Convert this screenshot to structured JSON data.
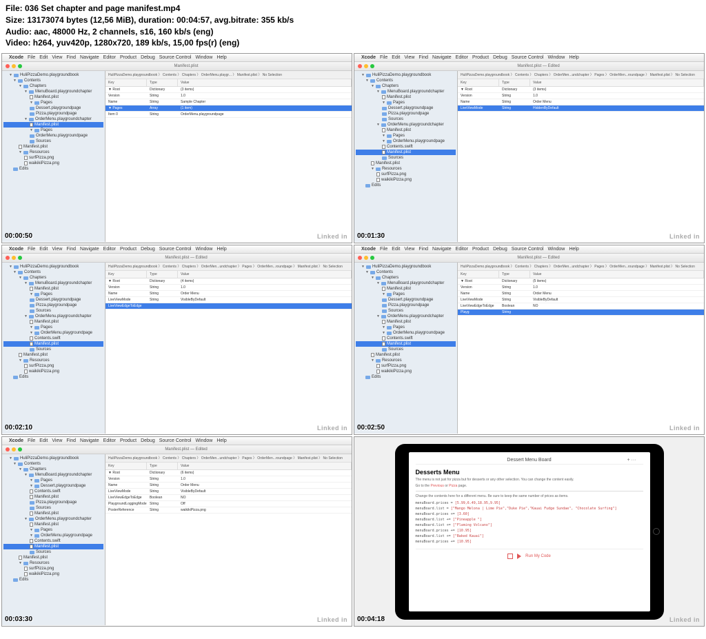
{
  "header": {
    "l1": "File: 036 Set chapter and page manifest.mp4",
    "l2": "Size: 13173074 bytes (12,56 MiB), duration: 00:04:57, avg.bitrate: 355 kb/s",
    "l3": "Audio: aac, 48000 Hz, 2 channels, s16, 160 kb/s (eng)",
    "l4": "Video: h264, yuv420p, 1280x720, 189 kb/s, 15,00 fps(r) (eng)"
  },
  "menu": [
    "Xcode",
    "File",
    "Edit",
    "View",
    "Find",
    "Navigate",
    "Editor",
    "Product",
    "Debug",
    "Source Control",
    "Window",
    "Help"
  ],
  "watermark": "Linked in",
  "plist_cols": {
    "key": "Key",
    "type": "Type",
    "value": "Value"
  },
  "thumbs": [
    {
      "ts": "00:00:50",
      "title": "Manifest.plist",
      "crumb": "HuliPizzaDemo.playgroundbook 〉 Contents 〉 Chapters 〉 OrderMenu.playgr... 〉 Manifest.plist 〉 No Selection",
      "tree": [
        {
          "t": "HuliPizzaDemo.playgroundbook",
          "d": 0,
          "o": 1,
          "f": 1
        },
        {
          "t": "Contents",
          "d": 1,
          "o": 1,
          "f": 1
        },
        {
          "t": "Chapters",
          "d": 2,
          "o": 1,
          "f": 1
        },
        {
          "t": "MenuBoard.playgroundchapter",
          "d": 3,
          "o": 1,
          "f": 1
        },
        {
          "t": "Manifest.plist",
          "d": 4
        },
        {
          "t": "Pages",
          "d": 4,
          "o": 1,
          "f": 1
        },
        {
          "t": "Dessert.playgroundpage",
          "d": 4,
          "f": 1
        },
        {
          "t": "Pizza.playgroundpage",
          "d": 4,
          "f": 1
        },
        {
          "t": "OrderMenu.playgroundchapter",
          "d": 3,
          "o": 1,
          "f": 1
        },
        {
          "t": "Manifest.plist",
          "d": 4,
          "sel": 1
        },
        {
          "t": "Pages",
          "d": 4,
          "o": 1,
          "f": 1
        },
        {
          "t": "OrderMenu.playgroundpage",
          "d": 4,
          "f": 1
        },
        {
          "t": "Sources",
          "d": 4,
          "f": 1
        },
        {
          "t": "Manifest.plist",
          "d": 2
        },
        {
          "t": "Resources",
          "d": 2,
          "o": 1,
          "f": 1
        },
        {
          "t": "surfPizza.png",
          "d": 3
        },
        {
          "t": "waikikiPizza.png",
          "d": 3
        },
        {
          "t": "Edits",
          "d": 1,
          "f": 1
        }
      ],
      "rows": [
        {
          "k": "▼ Root",
          "t": "Dictionary",
          "v": "(3 items)"
        },
        {
          "k": "  Version",
          "t": "String",
          "v": "1.0"
        },
        {
          "k": "  Name",
          "t": "String",
          "v": "Sample Chapter"
        },
        {
          "k": "  ▼ Pages",
          "t": "Array",
          "v": "(1 item)",
          "sel": 1
        },
        {
          "k": "    Item 0",
          "t": "String",
          "v": "OrderMenu.playgroundpage"
        }
      ]
    },
    {
      "ts": "00:01:30",
      "title": "Manifest.plist — Edited",
      "crumb": "HuliPizzaDemo.playgroundbook 〉 Contents 〉 Chapters 〉 OrderMen...undchapter 〉 Pages 〉 OrderMen...roundpage 〉 Manifest.plist 〉 No Selection",
      "tree": [
        {
          "t": "HuliPizzaDemo.playgroundbook",
          "d": 0,
          "o": 1,
          "f": 1
        },
        {
          "t": "Contents",
          "d": 1,
          "o": 1,
          "f": 1
        },
        {
          "t": "Chapters",
          "d": 2,
          "o": 1,
          "f": 1
        },
        {
          "t": "MenuBoard.playgroundchapter",
          "d": 3,
          "o": 1,
          "f": 1
        },
        {
          "t": "Manifest.plist",
          "d": 4
        },
        {
          "t": "Pages",
          "d": 4,
          "o": 1,
          "f": 1
        },
        {
          "t": "Dessert.playgroundpage",
          "d": 4,
          "f": 1
        },
        {
          "t": "Pizza.playgroundpage",
          "d": 4,
          "f": 1
        },
        {
          "t": "Sources",
          "d": 4,
          "f": 1
        },
        {
          "t": "OrderMenu.playgroundchapter",
          "d": 3,
          "o": 1,
          "f": 1
        },
        {
          "t": "Manifest.plist",
          "d": 4
        },
        {
          "t": "Pages",
          "d": 4,
          "o": 1,
          "f": 1
        },
        {
          "t": "OrderMenu.playgroundpage",
          "d": 4,
          "o": 1,
          "f": 1
        },
        {
          "t": "Contents.swift",
          "d": 4
        },
        {
          "t": "Manifest.plist",
          "d": 4,
          "sel": 1
        },
        {
          "t": "Sources",
          "d": 4,
          "f": 1
        },
        {
          "t": "Manifest.plist",
          "d": 2
        },
        {
          "t": "Resources",
          "d": 2,
          "o": 1,
          "f": 1
        },
        {
          "t": "surfPizza.png",
          "d": 3
        },
        {
          "t": "waikikiPizza.png",
          "d": 3
        },
        {
          "t": "Edits",
          "d": 1,
          "f": 1
        }
      ],
      "rows": [
        {
          "k": "▼ Root",
          "t": "Dictionary",
          "v": "(3 items)"
        },
        {
          "k": "  Version",
          "t": "String",
          "v": "1.0"
        },
        {
          "k": "  Name",
          "t": "String",
          "v": "Order Menu"
        },
        {
          "k": "  LiveViewMode",
          "t": "String",
          "v": "HiddenByDefault",
          "sel": 1
        }
      ]
    },
    {
      "ts": "00:02:10",
      "title": "Manifest.plist — Edited",
      "crumb": "HuliPizzaDemo.playgroundbook 〉 Contents 〉 Chapters 〉 OrderMen...undchapter 〉 Pages 〉 OrderMen...roundpage 〉 Manifest.plist 〉 No Selection",
      "tree": [
        {
          "t": "HuliPizzaDemo.playgroundbook",
          "d": 0,
          "o": 1,
          "f": 1
        },
        {
          "t": "Contents",
          "d": 1,
          "o": 1,
          "f": 1
        },
        {
          "t": "Chapters",
          "d": 2,
          "o": 1,
          "f": 1
        },
        {
          "t": "MenuBoard.playgroundchapter",
          "d": 3,
          "o": 1,
          "f": 1
        },
        {
          "t": "Manifest.plist",
          "d": 4
        },
        {
          "t": "Pages",
          "d": 4,
          "o": 1,
          "f": 1
        },
        {
          "t": "Dessert.playgroundpage",
          "d": 4,
          "f": 1
        },
        {
          "t": "Pizza.playgroundpage",
          "d": 4,
          "f": 1
        },
        {
          "t": "Sources",
          "d": 4,
          "f": 1
        },
        {
          "t": "OrderMenu.playgroundchapter",
          "d": 3,
          "o": 1,
          "f": 1
        },
        {
          "t": "Manifest.plist",
          "d": 4
        },
        {
          "t": "Pages",
          "d": 4,
          "o": 1,
          "f": 1
        },
        {
          "t": "OrderMenu.playgroundpage",
          "d": 4,
          "o": 1,
          "f": 1
        },
        {
          "t": "Contents.swift",
          "d": 4
        },
        {
          "t": "Manifest.plist",
          "d": 4,
          "sel": 1
        },
        {
          "t": "Sources",
          "d": 4,
          "f": 1
        },
        {
          "t": "Manifest.plist",
          "d": 2
        },
        {
          "t": "Resources",
          "d": 2,
          "o": 1,
          "f": 1
        },
        {
          "t": "surfPizza.png",
          "d": 3
        },
        {
          "t": "waikikiPizza.png",
          "d": 3
        },
        {
          "t": "Edits",
          "d": 1,
          "f": 1
        }
      ],
      "rows": [
        {
          "k": "▼ Root",
          "t": "Dictionary",
          "v": "(4 items)"
        },
        {
          "k": "  Version",
          "t": "String",
          "v": "1.0"
        },
        {
          "k": "  Name",
          "t": "String",
          "v": "Order Menu"
        },
        {
          "k": "  LiveViewMode",
          "t": "String",
          "v": "VisibleByDefault"
        },
        {
          "k": "  LiveViewEdgeToEdge",
          "t": "",
          "v": "",
          "sel": 1
        }
      ]
    },
    {
      "ts": "00:02:50",
      "title": "Manifest.plist — Edited",
      "crumb": "HuliPizzaDemo.playgroundbook 〉 Contents 〉 Chapters 〉 OrderMen...undchapter 〉 Pages 〉 OrderMen...roundpage 〉 Manifest.plist 〉 No Selection",
      "tree": [
        {
          "t": "HuliPizzaDemo.playgroundbook",
          "d": 0,
          "o": 1,
          "f": 1
        },
        {
          "t": "Contents",
          "d": 1,
          "o": 1,
          "f": 1
        },
        {
          "t": "Chapters",
          "d": 2,
          "o": 1,
          "f": 1
        },
        {
          "t": "MenuBoard.playgroundchapter",
          "d": 3,
          "o": 1,
          "f": 1
        },
        {
          "t": "Manifest.plist",
          "d": 4
        },
        {
          "t": "Pages",
          "d": 4,
          "o": 1,
          "f": 1
        },
        {
          "t": "Dessert.playgroundpage",
          "d": 4,
          "f": 1
        },
        {
          "t": "Pizza.playgroundpage",
          "d": 4,
          "f": 1
        },
        {
          "t": "Sources",
          "d": 4,
          "f": 1
        },
        {
          "t": "OrderMenu.playgroundchapter",
          "d": 3,
          "o": 1,
          "f": 1
        },
        {
          "t": "Manifest.plist",
          "d": 4
        },
        {
          "t": "Pages",
          "d": 4,
          "o": 1,
          "f": 1
        },
        {
          "t": "OrderMenu.playgroundpage",
          "d": 4,
          "o": 1,
          "f": 1
        },
        {
          "t": "Contents.swift",
          "d": 4
        },
        {
          "t": "Manifest.plist",
          "d": 4,
          "sel": 1
        },
        {
          "t": "Sources",
          "d": 4,
          "f": 1
        },
        {
          "t": "Manifest.plist",
          "d": 2
        },
        {
          "t": "Resources",
          "d": 2,
          "o": 1,
          "f": 1
        },
        {
          "t": "surfPizza.png",
          "d": 3
        },
        {
          "t": "waikikiPizza.png",
          "d": 3
        },
        {
          "t": "Edits",
          "d": 1,
          "f": 1
        }
      ],
      "rows": [
        {
          "k": "▼ Root",
          "t": "Dictionary",
          "v": "(5 items)"
        },
        {
          "k": "  Version",
          "t": "String",
          "v": "1.0"
        },
        {
          "k": "  Name",
          "t": "String",
          "v": "Order Menu"
        },
        {
          "k": "  LiveViewMode",
          "t": "String",
          "v": "VisibleByDefault"
        },
        {
          "k": "  LiveViewEdgeToEdge",
          "t": "Boolean",
          "v": "NO"
        },
        {
          "k": "  Playg",
          "t": "String",
          "v": "",
          "sel": 1
        }
      ]
    },
    {
      "ts": "00:03:30",
      "title": "Manifest.plist — Edited",
      "crumb": "HuliPizzaDemo.playgroundbook 〉 Contents 〉 Chapters 〉 OrderMen...undchapter 〉 Pages 〉 OrderMen...roundpage 〉 Manifest.plist 〉 No Selection",
      "tree": [
        {
          "t": "HuliPizzaDemo.playgroundbook",
          "d": 0,
          "o": 1,
          "f": 1
        },
        {
          "t": "Contents",
          "d": 1,
          "o": 1,
          "f": 1
        },
        {
          "t": "Chapters",
          "d": 2,
          "o": 1,
          "f": 1
        },
        {
          "t": "MenuBoard.playgroundchapter",
          "d": 3,
          "o": 1,
          "f": 1
        },
        {
          "t": "Pages",
          "d": 4,
          "o": 1,
          "f": 1
        },
        {
          "t": "Dessert.playgroundpage",
          "d": 4,
          "o": 1,
          "f": 1
        },
        {
          "t": "Contents.swift",
          "d": 4
        },
        {
          "t": "Manifest.plist",
          "d": 4
        },
        {
          "t": "Pizza.playgroundpage",
          "d": 4,
          "f": 1
        },
        {
          "t": "Sources",
          "d": 4,
          "f": 1
        },
        {
          "t": "Manifest.plist",
          "d": 4
        },
        {
          "t": "OrderMenu.playgroundchapter",
          "d": 3,
          "o": 1,
          "f": 1
        },
        {
          "t": "Manifest.plist",
          "d": 4
        },
        {
          "t": "Pages",
          "d": 4,
          "o": 1,
          "f": 1
        },
        {
          "t": "OrderMenu.playgroundpage",
          "d": 4,
          "o": 1,
          "f": 1
        },
        {
          "t": "Contents.swift",
          "d": 4
        },
        {
          "t": "Manifest.plist",
          "d": 4,
          "sel": 1
        },
        {
          "t": "Sources",
          "d": 4,
          "f": 1
        },
        {
          "t": "Manifest.plist",
          "d": 2
        },
        {
          "t": "Resources",
          "d": 2,
          "o": 1,
          "f": 1
        },
        {
          "t": "surfPizza.png",
          "d": 3
        },
        {
          "t": "waikikiPizza.png",
          "d": 3
        },
        {
          "t": "Edits",
          "d": 1,
          "f": 1
        }
      ],
      "rows": [
        {
          "k": "▼ Root",
          "t": "Dictionary",
          "v": "(6 items)"
        },
        {
          "k": "  Version",
          "t": "String",
          "v": "1.0"
        },
        {
          "k": "  Name",
          "t": "String",
          "v": "Order Menu"
        },
        {
          "k": "  LiveViewMode",
          "t": "String",
          "v": "VisibleByDefault"
        },
        {
          "k": "  LiveViewEdgeToEdge",
          "t": "Boolean",
          "v": "NO"
        },
        {
          "k": "  PlaygroundLoggingMode",
          "t": "String",
          "v": "Off"
        },
        {
          "k": "  PosterReference",
          "t": "String",
          "v": "waikikiPizza.png"
        }
      ]
    }
  ],
  "ipad": {
    "ts": "00:04:18",
    "topbar": "Dessert Menu Board",
    "h": "Desserts Menu",
    "p1_a": "The menu is not just for pizza but for desserts or any other selection. You can change the content easily.",
    "p1_b": "Go to the ",
    "p1_link1": "Previous",
    "p1_mid": " or ",
    "p1_link2": "Pizza",
    "p1_c": " page.",
    "p2": "Change the contents here for a different menu. Be sure to keep the same number of prices as items.",
    "code": [
      {
        "a": "menuBoard.prices = ",
        "b": "[5.99,6.49,18.95,9.95]"
      },
      {
        "a": "menuBoard.list = ",
        "b": "[\"Mango Melona | Lime Pie\",\"Duke Pie\",\"Kauai Fudge Sundae\", \"Chocolate Surfing\"]"
      },
      {
        "a": "menuBoard.prices += ",
        "b": "[3.60]"
      },
      {
        "a": "menuBoard.list += ",
        "b": "[\"Pineapple \"]"
      },
      {
        "a": "menuBoard.list += ",
        "b": "[\"Flaming Volcano\"]"
      },
      {
        "a": "menuBoard.prices += ",
        "b": "[10.95]"
      },
      {
        "a": "menuBoard.list += ",
        "b": "[\"Baked Kauai\"]"
      },
      {
        "a": "menuBoard.prices += ",
        "b": "[10.95]"
      }
    ],
    "run": "Run My Code"
  }
}
